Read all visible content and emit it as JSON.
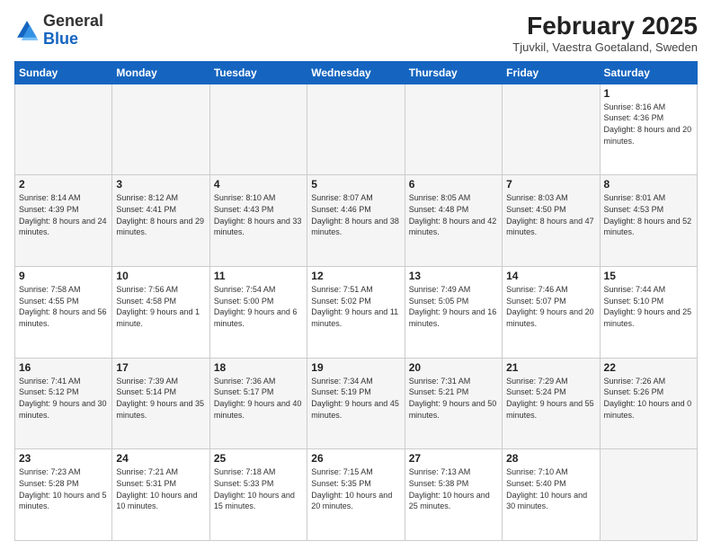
{
  "header": {
    "logo_general": "General",
    "logo_blue": "Blue",
    "month_year": "February 2025",
    "location": "Tjuvkil, Vaestra Goetaland, Sweden"
  },
  "weekdays": [
    "Sunday",
    "Monday",
    "Tuesday",
    "Wednesday",
    "Thursday",
    "Friday",
    "Saturday"
  ],
  "weeks": [
    [
      {
        "day": "",
        "info": ""
      },
      {
        "day": "",
        "info": ""
      },
      {
        "day": "",
        "info": ""
      },
      {
        "day": "",
        "info": ""
      },
      {
        "day": "",
        "info": ""
      },
      {
        "day": "",
        "info": ""
      },
      {
        "day": "1",
        "info": "Sunrise: 8:16 AM\nSunset: 4:36 PM\nDaylight: 8 hours and 20 minutes."
      }
    ],
    [
      {
        "day": "2",
        "info": "Sunrise: 8:14 AM\nSunset: 4:39 PM\nDaylight: 8 hours and 24 minutes."
      },
      {
        "day": "3",
        "info": "Sunrise: 8:12 AM\nSunset: 4:41 PM\nDaylight: 8 hours and 29 minutes."
      },
      {
        "day": "4",
        "info": "Sunrise: 8:10 AM\nSunset: 4:43 PM\nDaylight: 8 hours and 33 minutes."
      },
      {
        "day": "5",
        "info": "Sunrise: 8:07 AM\nSunset: 4:46 PM\nDaylight: 8 hours and 38 minutes."
      },
      {
        "day": "6",
        "info": "Sunrise: 8:05 AM\nSunset: 4:48 PM\nDaylight: 8 hours and 42 minutes."
      },
      {
        "day": "7",
        "info": "Sunrise: 8:03 AM\nSunset: 4:50 PM\nDaylight: 8 hours and 47 minutes."
      },
      {
        "day": "8",
        "info": "Sunrise: 8:01 AM\nSunset: 4:53 PM\nDaylight: 8 hours and 52 minutes."
      }
    ],
    [
      {
        "day": "9",
        "info": "Sunrise: 7:58 AM\nSunset: 4:55 PM\nDaylight: 8 hours and 56 minutes."
      },
      {
        "day": "10",
        "info": "Sunrise: 7:56 AM\nSunset: 4:58 PM\nDaylight: 9 hours and 1 minute."
      },
      {
        "day": "11",
        "info": "Sunrise: 7:54 AM\nSunset: 5:00 PM\nDaylight: 9 hours and 6 minutes."
      },
      {
        "day": "12",
        "info": "Sunrise: 7:51 AM\nSunset: 5:02 PM\nDaylight: 9 hours and 11 minutes."
      },
      {
        "day": "13",
        "info": "Sunrise: 7:49 AM\nSunset: 5:05 PM\nDaylight: 9 hours and 16 minutes."
      },
      {
        "day": "14",
        "info": "Sunrise: 7:46 AM\nSunset: 5:07 PM\nDaylight: 9 hours and 20 minutes."
      },
      {
        "day": "15",
        "info": "Sunrise: 7:44 AM\nSunset: 5:10 PM\nDaylight: 9 hours and 25 minutes."
      }
    ],
    [
      {
        "day": "16",
        "info": "Sunrise: 7:41 AM\nSunset: 5:12 PM\nDaylight: 9 hours and 30 minutes."
      },
      {
        "day": "17",
        "info": "Sunrise: 7:39 AM\nSunset: 5:14 PM\nDaylight: 9 hours and 35 minutes."
      },
      {
        "day": "18",
        "info": "Sunrise: 7:36 AM\nSunset: 5:17 PM\nDaylight: 9 hours and 40 minutes."
      },
      {
        "day": "19",
        "info": "Sunrise: 7:34 AM\nSunset: 5:19 PM\nDaylight: 9 hours and 45 minutes."
      },
      {
        "day": "20",
        "info": "Sunrise: 7:31 AM\nSunset: 5:21 PM\nDaylight: 9 hours and 50 minutes."
      },
      {
        "day": "21",
        "info": "Sunrise: 7:29 AM\nSunset: 5:24 PM\nDaylight: 9 hours and 55 minutes."
      },
      {
        "day": "22",
        "info": "Sunrise: 7:26 AM\nSunset: 5:26 PM\nDaylight: 10 hours and 0 minutes."
      }
    ],
    [
      {
        "day": "23",
        "info": "Sunrise: 7:23 AM\nSunset: 5:28 PM\nDaylight: 10 hours and 5 minutes."
      },
      {
        "day": "24",
        "info": "Sunrise: 7:21 AM\nSunset: 5:31 PM\nDaylight: 10 hours and 10 minutes."
      },
      {
        "day": "25",
        "info": "Sunrise: 7:18 AM\nSunset: 5:33 PM\nDaylight: 10 hours and 15 minutes."
      },
      {
        "day": "26",
        "info": "Sunrise: 7:15 AM\nSunset: 5:35 PM\nDaylight: 10 hours and 20 minutes."
      },
      {
        "day": "27",
        "info": "Sunrise: 7:13 AM\nSunset: 5:38 PM\nDaylight: 10 hours and 25 minutes."
      },
      {
        "day": "28",
        "info": "Sunrise: 7:10 AM\nSunset: 5:40 PM\nDaylight: 10 hours and 30 minutes."
      },
      {
        "day": "",
        "info": ""
      }
    ]
  ]
}
